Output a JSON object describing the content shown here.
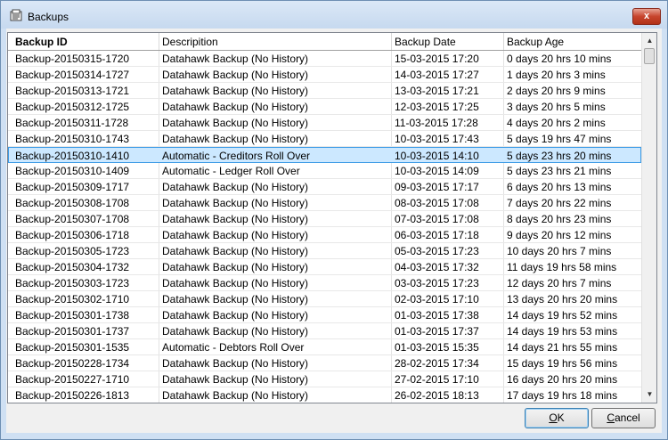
{
  "window": {
    "title": "Backups",
    "close_glyph": "x",
    "icon": "backup-folder-icon"
  },
  "table": {
    "columns": [
      "Backup ID",
      "Descripition",
      "Backup Date",
      "Backup Age"
    ],
    "selected_index": 6,
    "rows": [
      [
        "Backup-20150315-1720",
        "Datahawk Backup (No History)",
        "15-03-2015 17:20",
        "0 days 20 hrs 10 mins"
      ],
      [
        "Backup-20150314-1727",
        "Datahawk Backup (No History)",
        "14-03-2015 17:27",
        "1 days 20 hrs  3 mins"
      ],
      [
        "Backup-20150313-1721",
        "Datahawk Backup (No History)",
        "13-03-2015 17:21",
        "2 days 20 hrs  9 mins"
      ],
      [
        "Backup-20150312-1725",
        "Datahawk Backup (No History)",
        "12-03-2015 17:25",
        "3 days 20 hrs  5 mins"
      ],
      [
        "Backup-20150311-1728",
        "Datahawk Backup (No History)",
        "11-03-2015 17:28",
        "4 days 20 hrs  2 mins"
      ],
      [
        "Backup-20150310-1743",
        "Datahawk Backup (No History)",
        "10-03-2015 17:43",
        "5 days 19 hrs 47 mins"
      ],
      [
        "Backup-20150310-1410",
        "Automatic - Creditors Roll Over",
        "10-03-2015 14:10",
        "5 days 23 hrs 20 mins"
      ],
      [
        "Backup-20150310-1409",
        "Automatic - Ledger Roll Over",
        "10-03-2015 14:09",
        "5 days 23 hrs 21 mins"
      ],
      [
        "Backup-20150309-1717",
        "Datahawk Backup (No History)",
        "09-03-2015 17:17",
        "6 days 20 hrs 13 mins"
      ],
      [
        "Backup-20150308-1708",
        "Datahawk Backup (No History)",
        "08-03-2015 17:08",
        "7 days 20 hrs 22 mins"
      ],
      [
        "Backup-20150307-1708",
        "Datahawk Backup (No History)",
        "07-03-2015 17:08",
        "8 days 20 hrs 23 mins"
      ],
      [
        "Backup-20150306-1718",
        "Datahawk Backup (No History)",
        "06-03-2015 17:18",
        "9 days 20 hrs 12 mins"
      ],
      [
        "Backup-20150305-1723",
        "Datahawk Backup (No History)",
        "05-03-2015 17:23",
        "10 days 20 hrs  7 mins"
      ],
      [
        "Backup-20150304-1732",
        "Datahawk Backup (No History)",
        "04-03-2015 17:32",
        "11 days 19 hrs 58 mins"
      ],
      [
        "Backup-20150303-1723",
        "Datahawk Backup (No History)",
        "03-03-2015 17:23",
        "12 days 20 hrs  7 mins"
      ],
      [
        "Backup-20150302-1710",
        "Datahawk Backup (No History)",
        "02-03-2015 17:10",
        "13 days 20 hrs 20 mins"
      ],
      [
        "Backup-20150301-1738",
        "Datahawk Backup (No History)",
        "01-03-2015 17:38",
        "14 days 19 hrs 52 mins"
      ],
      [
        "Backup-20150301-1737",
        "Datahawk Backup (No History)",
        "01-03-2015 17:37",
        "14 days 19 hrs 53 mins"
      ],
      [
        "Backup-20150301-1535",
        "Automatic - Debtors Roll Over",
        "01-03-2015 15:35",
        "14 days 21 hrs 55 mins"
      ],
      [
        "Backup-20150228-1734",
        "Datahawk Backup (No History)",
        "28-02-2015 17:34",
        "15 days 19 hrs 56 mins"
      ],
      [
        "Backup-20150227-1710",
        "Datahawk Backup (No History)",
        "27-02-2015 17:10",
        "16 days 20 hrs 20 mins"
      ],
      [
        "Backup-20150226-1813",
        "Datahawk Backup (No History)",
        "26-02-2015 18:13",
        "17 days 19 hrs 18 mins"
      ]
    ]
  },
  "buttons": {
    "ok": "OK",
    "cancel": "Cancel"
  },
  "scrollbar": {
    "up_glyph": "▲",
    "down_glyph": "▼"
  }
}
